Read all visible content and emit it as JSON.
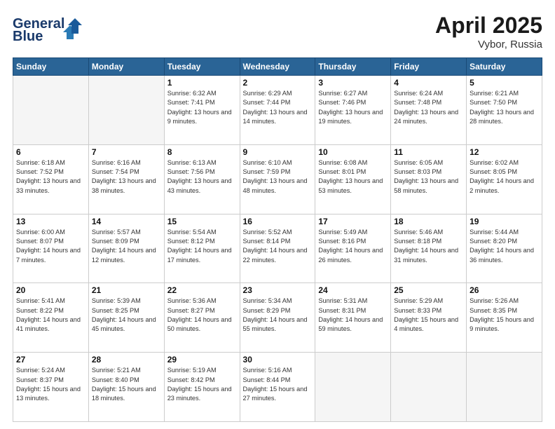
{
  "header": {
    "logo_line1": "General",
    "logo_line2": "Blue",
    "month": "April 2025",
    "location": "Vybor, Russia"
  },
  "weekdays": [
    "Sunday",
    "Monday",
    "Tuesday",
    "Wednesday",
    "Thursday",
    "Friday",
    "Saturday"
  ],
  "weeks": [
    [
      {
        "day": "",
        "empty": true
      },
      {
        "day": "",
        "empty": true
      },
      {
        "day": "1",
        "sunrise": "Sunrise: 6:32 AM",
        "sunset": "Sunset: 7:41 PM",
        "daylight": "Daylight: 13 hours and 9 minutes."
      },
      {
        "day": "2",
        "sunrise": "Sunrise: 6:29 AM",
        "sunset": "Sunset: 7:44 PM",
        "daylight": "Daylight: 13 hours and 14 minutes."
      },
      {
        "day": "3",
        "sunrise": "Sunrise: 6:27 AM",
        "sunset": "Sunset: 7:46 PM",
        "daylight": "Daylight: 13 hours and 19 minutes."
      },
      {
        "day": "4",
        "sunrise": "Sunrise: 6:24 AM",
        "sunset": "Sunset: 7:48 PM",
        "daylight": "Daylight: 13 hours and 24 minutes."
      },
      {
        "day": "5",
        "sunrise": "Sunrise: 6:21 AM",
        "sunset": "Sunset: 7:50 PM",
        "daylight": "Daylight: 13 hours and 28 minutes."
      }
    ],
    [
      {
        "day": "6",
        "sunrise": "Sunrise: 6:18 AM",
        "sunset": "Sunset: 7:52 PM",
        "daylight": "Daylight: 13 hours and 33 minutes."
      },
      {
        "day": "7",
        "sunrise": "Sunrise: 6:16 AM",
        "sunset": "Sunset: 7:54 PM",
        "daylight": "Daylight: 13 hours and 38 minutes."
      },
      {
        "day": "8",
        "sunrise": "Sunrise: 6:13 AM",
        "sunset": "Sunset: 7:56 PM",
        "daylight": "Daylight: 13 hours and 43 minutes."
      },
      {
        "day": "9",
        "sunrise": "Sunrise: 6:10 AM",
        "sunset": "Sunset: 7:59 PM",
        "daylight": "Daylight: 13 hours and 48 minutes."
      },
      {
        "day": "10",
        "sunrise": "Sunrise: 6:08 AM",
        "sunset": "Sunset: 8:01 PM",
        "daylight": "Daylight: 13 hours and 53 minutes."
      },
      {
        "day": "11",
        "sunrise": "Sunrise: 6:05 AM",
        "sunset": "Sunset: 8:03 PM",
        "daylight": "Daylight: 13 hours and 58 minutes."
      },
      {
        "day": "12",
        "sunrise": "Sunrise: 6:02 AM",
        "sunset": "Sunset: 8:05 PM",
        "daylight": "Daylight: 14 hours and 2 minutes."
      }
    ],
    [
      {
        "day": "13",
        "sunrise": "Sunrise: 6:00 AM",
        "sunset": "Sunset: 8:07 PM",
        "daylight": "Daylight: 14 hours and 7 minutes."
      },
      {
        "day": "14",
        "sunrise": "Sunrise: 5:57 AM",
        "sunset": "Sunset: 8:09 PM",
        "daylight": "Daylight: 14 hours and 12 minutes."
      },
      {
        "day": "15",
        "sunrise": "Sunrise: 5:54 AM",
        "sunset": "Sunset: 8:12 PM",
        "daylight": "Daylight: 14 hours and 17 minutes."
      },
      {
        "day": "16",
        "sunrise": "Sunrise: 5:52 AM",
        "sunset": "Sunset: 8:14 PM",
        "daylight": "Daylight: 14 hours and 22 minutes."
      },
      {
        "day": "17",
        "sunrise": "Sunrise: 5:49 AM",
        "sunset": "Sunset: 8:16 PM",
        "daylight": "Daylight: 14 hours and 26 minutes."
      },
      {
        "day": "18",
        "sunrise": "Sunrise: 5:46 AM",
        "sunset": "Sunset: 8:18 PM",
        "daylight": "Daylight: 14 hours and 31 minutes."
      },
      {
        "day": "19",
        "sunrise": "Sunrise: 5:44 AM",
        "sunset": "Sunset: 8:20 PM",
        "daylight": "Daylight: 14 hours and 36 minutes."
      }
    ],
    [
      {
        "day": "20",
        "sunrise": "Sunrise: 5:41 AM",
        "sunset": "Sunset: 8:22 PM",
        "daylight": "Daylight: 14 hours and 41 minutes."
      },
      {
        "day": "21",
        "sunrise": "Sunrise: 5:39 AM",
        "sunset": "Sunset: 8:25 PM",
        "daylight": "Daylight: 14 hours and 45 minutes."
      },
      {
        "day": "22",
        "sunrise": "Sunrise: 5:36 AM",
        "sunset": "Sunset: 8:27 PM",
        "daylight": "Daylight: 14 hours and 50 minutes."
      },
      {
        "day": "23",
        "sunrise": "Sunrise: 5:34 AM",
        "sunset": "Sunset: 8:29 PM",
        "daylight": "Daylight: 14 hours and 55 minutes."
      },
      {
        "day": "24",
        "sunrise": "Sunrise: 5:31 AM",
        "sunset": "Sunset: 8:31 PM",
        "daylight": "Daylight: 14 hours and 59 minutes."
      },
      {
        "day": "25",
        "sunrise": "Sunrise: 5:29 AM",
        "sunset": "Sunset: 8:33 PM",
        "daylight": "Daylight: 15 hours and 4 minutes."
      },
      {
        "day": "26",
        "sunrise": "Sunrise: 5:26 AM",
        "sunset": "Sunset: 8:35 PM",
        "daylight": "Daylight: 15 hours and 9 minutes."
      }
    ],
    [
      {
        "day": "27",
        "sunrise": "Sunrise: 5:24 AM",
        "sunset": "Sunset: 8:37 PM",
        "daylight": "Daylight: 15 hours and 13 minutes."
      },
      {
        "day": "28",
        "sunrise": "Sunrise: 5:21 AM",
        "sunset": "Sunset: 8:40 PM",
        "daylight": "Daylight: 15 hours and 18 minutes."
      },
      {
        "day": "29",
        "sunrise": "Sunrise: 5:19 AM",
        "sunset": "Sunset: 8:42 PM",
        "daylight": "Daylight: 15 hours and 23 minutes."
      },
      {
        "day": "30",
        "sunrise": "Sunrise: 5:16 AM",
        "sunset": "Sunset: 8:44 PM",
        "daylight": "Daylight: 15 hours and 27 minutes."
      },
      {
        "day": "",
        "empty": true
      },
      {
        "day": "",
        "empty": true
      },
      {
        "day": "",
        "empty": true
      }
    ]
  ]
}
